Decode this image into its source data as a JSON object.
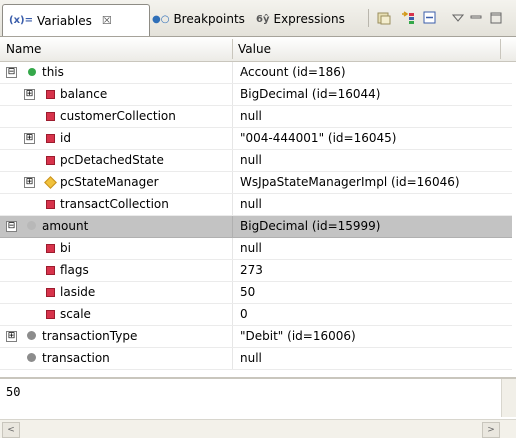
{
  "tabs": [
    {
      "label": "Variables",
      "glyph": "(x)=",
      "close": "☒"
    },
    {
      "label": "Breakpoints",
      "glyph": "●○"
    },
    {
      "label": "Expressions",
      "glyph": "6ŷ"
    }
  ],
  "toolbar_icons": [
    "show-type-names-icon",
    "show-logical-structure-icon",
    "collapse-all-icon",
    "view-menu-icon",
    "minimize-icon",
    "maximize-icon"
  ],
  "columns": {
    "name": "Name",
    "value": "Value"
  },
  "rows": [
    {
      "name": "this",
      "value": "Account  (id=186)",
      "icon": "this",
      "expander": "⊟"
    },
    {
      "name": "balance",
      "value": "BigDecimal  (id=16044)",
      "icon": "field",
      "expander": "⊞"
    },
    {
      "name": "customerCollection",
      "value": "null",
      "icon": "field",
      "expander": ""
    },
    {
      "name": "id",
      "value": "\"004-444001\" (id=16045)",
      "icon": "field",
      "expander": "⊞"
    },
    {
      "name": "pcDetachedState",
      "value": "null",
      "icon": "field",
      "expander": ""
    },
    {
      "name": "pcStateManager",
      "value": "WsJpaStateManagerImpl  (id=16046)",
      "icon": "diamond",
      "expander": "⊞"
    },
    {
      "name": "transactCollection",
      "value": "null",
      "icon": "field",
      "expander": ""
    },
    {
      "name": "amount",
      "value": "BigDecimal  (id=15999)",
      "icon": "local",
      "expander": "⊟",
      "selected": true
    },
    {
      "name": "bi",
      "value": "null",
      "icon": "field",
      "expander": ""
    },
    {
      "name": "flags",
      "value": "273",
      "icon": "field",
      "expander": ""
    },
    {
      "name": "laside",
      "value": "50",
      "icon": "field",
      "expander": ""
    },
    {
      "name": "scale",
      "value": "0",
      "icon": "field",
      "expander": ""
    },
    {
      "name": "transactionType",
      "value": "\"Debit\" (id=16006)",
      "icon": "local",
      "expander": "⊞"
    },
    {
      "name": "transaction",
      "value": "null",
      "icon": "local",
      "expander": ""
    }
  ],
  "detail": {
    "text": "50"
  },
  "colors": {
    "selected_row": "#c3c3c3",
    "field_icon": "#d7334b",
    "this_icon": "#35a84a"
  }
}
